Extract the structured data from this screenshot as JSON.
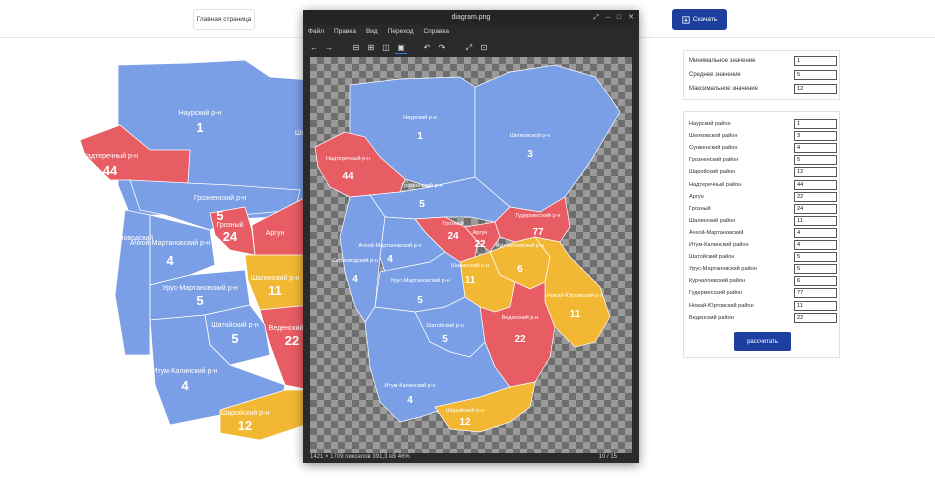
{
  "header": {
    "home_label": "Главная страница",
    "download_label": "Скачать"
  },
  "colors": {
    "blue": "#7b9fe6",
    "red": "#e85c63",
    "yellow": "#f2b733",
    "button": "#1d3fa0"
  },
  "background_map": {
    "labels": [
      {
        "name": "Наурский р-н",
        "value": "1"
      },
      {
        "name": "Надтеречный р-н",
        "value": "44"
      },
      {
        "name": "Грозненский р-н",
        "value": "5"
      },
      {
        "name": "Грозный",
        "value": "24"
      },
      {
        "name": "Урус-Мартановский р-н",
        "value": "5"
      },
      {
        "name": "Шалинский р-н",
        "value": "11"
      },
      {
        "name": "Шатойский р-н",
        "value": "5"
      },
      {
        "name": "Итум-Калинский р-н",
        "value": "4"
      },
      {
        "name": "Шаройский р-н",
        "value": "12"
      },
      {
        "name": "Ачхой-Мартановский р-н",
        "value": "4"
      },
      {
        "name": "Веденский р-н",
        "value": "22"
      },
      {
        "name": "Аргун",
        "value": "22"
      },
      {
        "name": "Шел",
        "value": ""
      },
      {
        "name": "Серноводский",
        "value": ""
      }
    ]
  },
  "viewer": {
    "title": "diagram.png",
    "menu": [
      "Файл",
      "Правка",
      "Вид",
      "Переход",
      "Справка"
    ],
    "status_left": "1421 × 1709 пикселов  391,3 kB   46%",
    "status_right": "10 / 15",
    "map_labels": [
      {
        "name": "Наурский р-н",
        "value": "1"
      },
      {
        "name": "Шелковской р-н",
        "value": "3"
      },
      {
        "name": "Надтеречный р-н",
        "value": "44"
      },
      {
        "name": "Грозненский р-н",
        "value": "5"
      },
      {
        "name": "Грозный",
        "value": "24"
      },
      {
        "name": "Гудермесский р-н",
        "value": "77"
      },
      {
        "name": "Аргун",
        "value": "22"
      },
      {
        "name": "Курчалоевский р-н",
        "value": "6"
      },
      {
        "name": "Шалинский р-н",
        "value": "11"
      },
      {
        "name": "Ачхой-Мартановский р-н",
        "value": "4"
      },
      {
        "name": "Урус-Мартановский р-н",
        "value": "5"
      },
      {
        "name": "Ножай-Юртовский р-н",
        "value": "11"
      },
      {
        "name": "Веденский р-н",
        "value": "22"
      },
      {
        "name": "Шатойский р-н",
        "value": "5"
      },
      {
        "name": "Итум-Калинский р-н",
        "value": "4"
      },
      {
        "name": "Шаройский р-н",
        "value": "12"
      },
      {
        "name": "Серноводский р-н",
        "value": "4"
      }
    ]
  },
  "stats": [
    {
      "label": "Минимальное значение",
      "value": "1"
    },
    {
      "label": "Среднее значение",
      "value": "5"
    },
    {
      "label": "Максимальное значение",
      "value": "12"
    }
  ],
  "regions": [
    {
      "label": "Наурский район",
      "value": "1"
    },
    {
      "label": "Шелковской район",
      "value": "3"
    },
    {
      "label": "Сунженский район",
      "value": "4"
    },
    {
      "label": "Грозненский район",
      "value": "5"
    },
    {
      "label": "Шаройский район",
      "value": "12"
    },
    {
      "label": "Надтеречный район",
      "value": "44"
    },
    {
      "label": "Аргун",
      "value": "22"
    },
    {
      "label": "Грозный",
      "value": "24"
    },
    {
      "label": "Шалинский район",
      "value": "11"
    },
    {
      "label": "Ачхой-Мартановский",
      "value": "4"
    },
    {
      "label": "Итум-Калинский район",
      "value": "4"
    },
    {
      "label": "Шатойский район",
      "value": "5"
    },
    {
      "label": "Урус-Мартановский район",
      "value": "5"
    },
    {
      "label": "Курчалоевский район",
      "value": "6"
    },
    {
      "label": "Гудермесский район",
      "value": "77"
    },
    {
      "label": "Ножай-Юртовский район",
      "value": "11"
    },
    {
      "label": "Веденский район",
      "value": "22"
    }
  ],
  "calculate_label": "рассчитать"
}
